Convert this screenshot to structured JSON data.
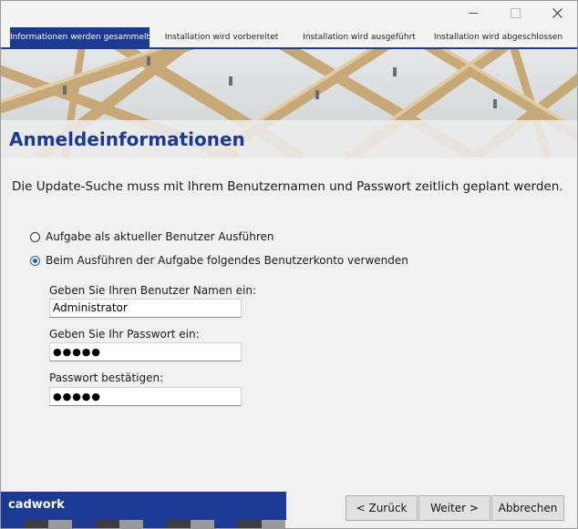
{
  "tabs": [
    {
      "label": "Informationen werden gesammelt",
      "active": true
    },
    {
      "label": "Installation wird vorbereitet",
      "active": false
    },
    {
      "label": "Installation wird ausgeführt",
      "active": false
    },
    {
      "label": "Installation wird abgeschlossen",
      "active": false
    }
  ],
  "banner": {
    "title": "Anmeldeinformationen"
  },
  "intro": "Die Update-Suche muss mit Ihrem Benutzernamen und Passwort zeitlich geplant werden.",
  "options": [
    {
      "label": "Aufgabe als aktueller Benutzer Ausführen",
      "checked": false
    },
    {
      "label": "Beim Ausführen der Aufgabe folgendes Benutzerkonto verwenden",
      "checked": true
    }
  ],
  "fields": {
    "username_label": "Geben Sie Ihren Benutzer Namen ein:",
    "username_value": "Administrator",
    "password_label": "Geben Sie Ihr Passwort ein:",
    "password_value": "●●●●●",
    "confirm_label": "Passwort bestätigen:",
    "confirm_value": "●●●●●"
  },
  "footer": {
    "brand": "cadwork",
    "back_label": "< Zurück",
    "next_label": "Weiter >",
    "cancel_label": "Abbrechen"
  },
  "colors": {
    "accent": "#1c3994",
    "strip": [
      "#1c3994",
      "#3a3a3a",
      "#9a9a9a"
    ]
  },
  "icons": [
    "minimize-icon",
    "maximize-icon",
    "close-icon"
  ]
}
